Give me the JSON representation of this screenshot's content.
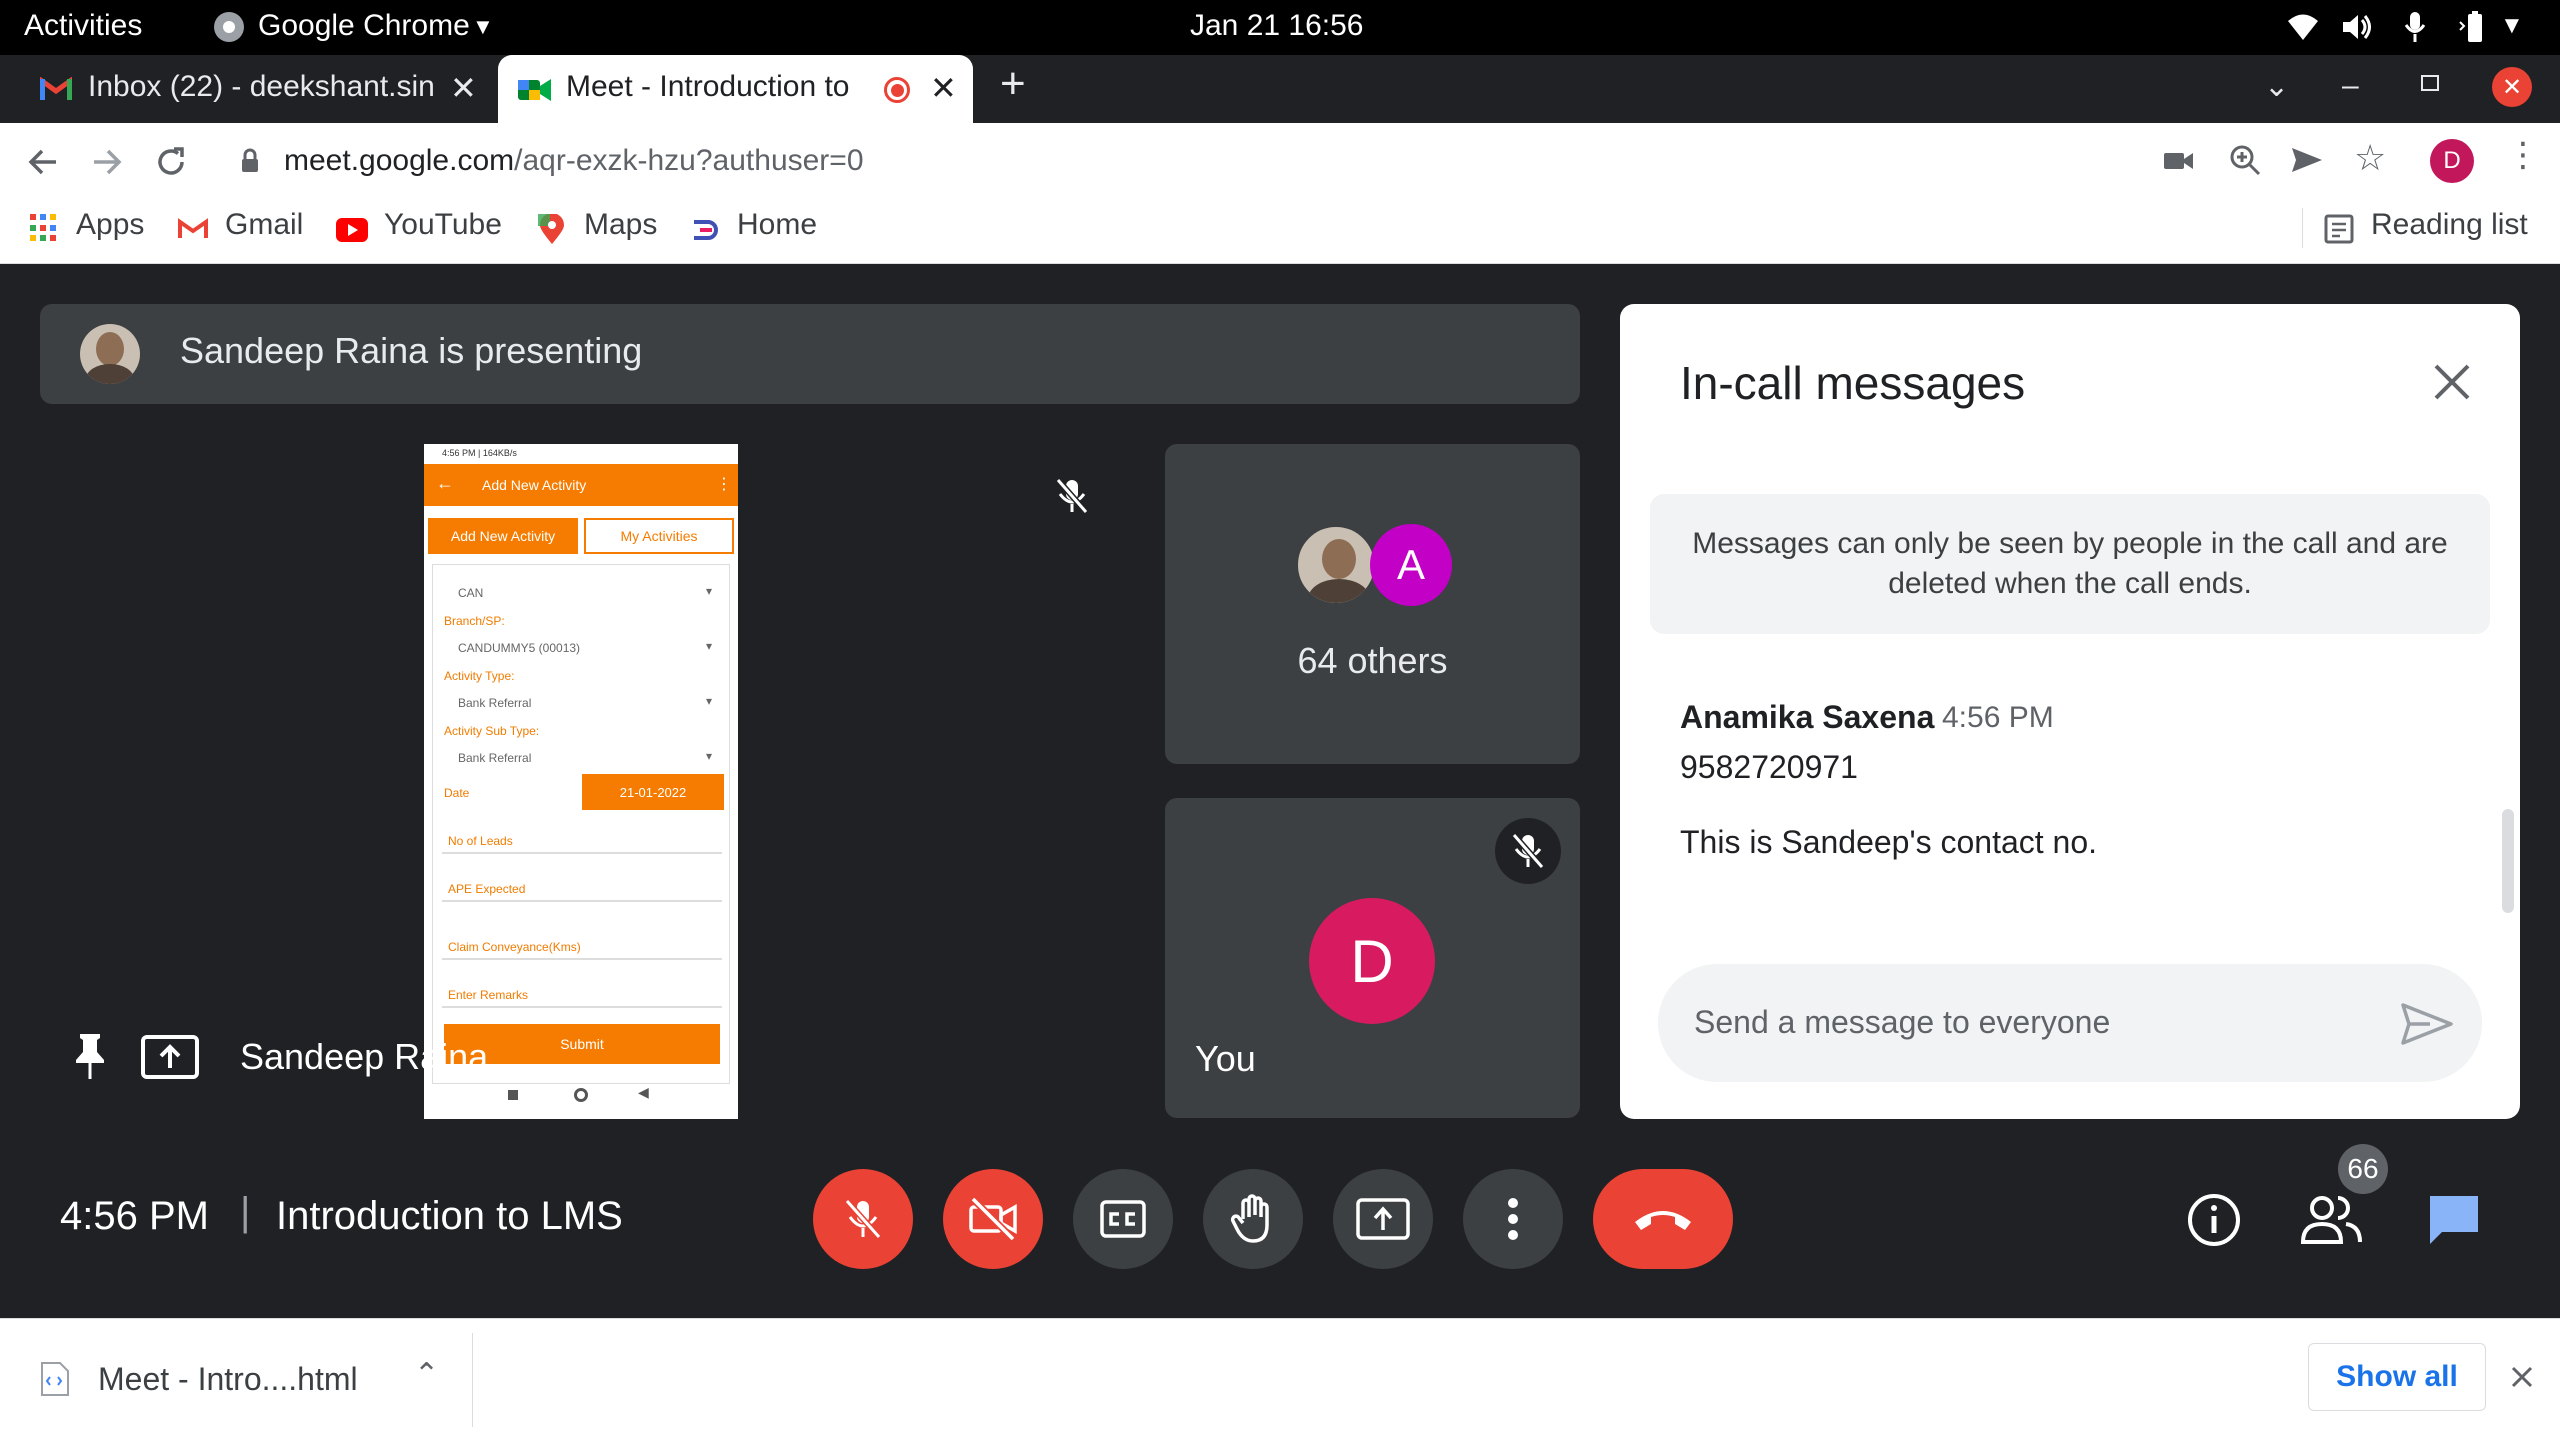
{
  "topbar": {
    "activities": "Activities",
    "app_name": "Google Chrome",
    "datetime": "Jan 21  16:56"
  },
  "tabs": [
    {
      "label": "Inbox (22) - deekshant.sin",
      "close": "✕"
    },
    {
      "label": "Meet - Introduction to",
      "close": "✕"
    }
  ],
  "new_tab": "+",
  "address": {
    "host": "meet.google.com",
    "path": "/aqr-exzk-hzu?authuser=0"
  },
  "profile_initial": "D",
  "bookmarks": {
    "items": [
      "Apps",
      "Gmail",
      "YouTube",
      "Maps",
      "Home"
    ],
    "reading_list": "Reading list"
  },
  "meet": {
    "presenting_text": "Sandeep Raina is presenting",
    "presenter_name": "Sandeep Raina",
    "others_avatar_letter": "A",
    "others_label": "64 others",
    "you_initial": "D",
    "you_label": "You",
    "time": "4:56 PM",
    "separator": "|",
    "meeting_title": "Introduction to LMS",
    "participants_count": "66"
  },
  "phone": {
    "status_bar": "4:56 PM | 164KB/s",
    "header": "Add New Activity",
    "tab_add": "Add New Activity",
    "tab_my": "My Activities",
    "can": "CAN",
    "branch_label": "Branch/SP:",
    "branch_value": "CANDUMMY5 (00013)",
    "activity_type_label": "Activity Type:",
    "activity_type_value": "Bank Referral",
    "activity_sub_type_label": "Activity Sub Type:",
    "activity_sub_type_value": "Bank Referral",
    "date_label": "Date",
    "date_value": "21-01-2022",
    "no_of_leads": "No of Leads",
    "ape_expected": "APE Expected",
    "claim_conveyance": "Claim Conveyance(Kms)",
    "enter_remarks": "Enter Remarks",
    "submit": "Submit"
  },
  "chat": {
    "title": "In-call messages",
    "notice": "Messages can only be seen by people in the call and are deleted when the call ends.",
    "message": {
      "sender": "Anamika Saxena",
      "time": "4:56 PM",
      "lines": [
        "9582720971",
        "This is Sandeep's contact no."
      ]
    },
    "input_placeholder": "Send a message to everyone"
  },
  "downloads": {
    "file_name": "Meet - Intro....html",
    "show_all": "Show all"
  },
  "colors": {
    "meet_red": "#ea4335",
    "end_call_red": "#ea4335",
    "chat_blue": "#8ab4f8",
    "orange": "#f57c00",
    "avatar_purple": "#c200c6",
    "avatar_magenta": "#d81b60"
  }
}
